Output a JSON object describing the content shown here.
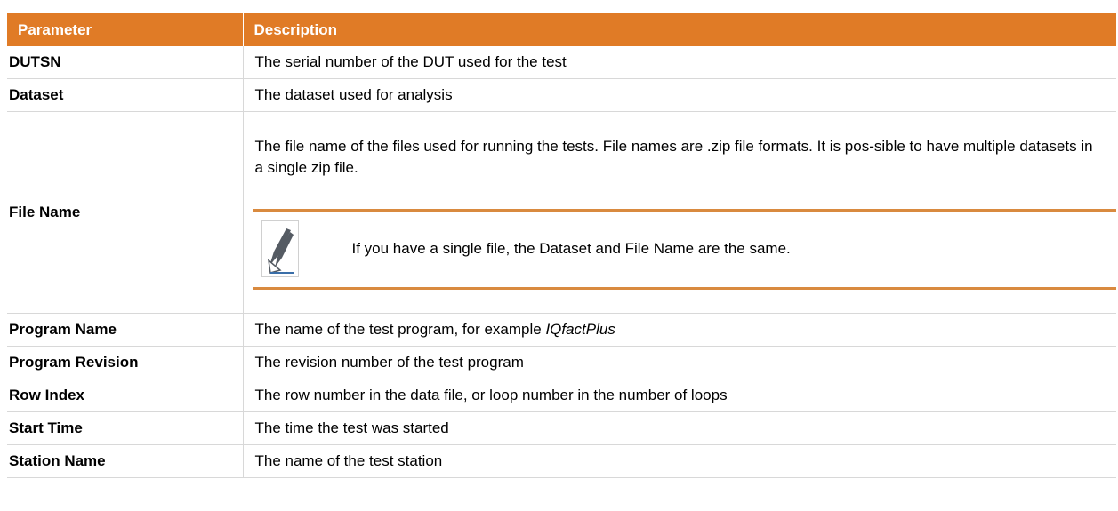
{
  "table": {
    "headers": {
      "param": "Parameter",
      "desc": "Description"
    },
    "rows": [
      {
        "param": "DUTSN",
        "desc": "The serial number of the DUT used for the test"
      },
      {
        "param": "Dataset",
        "desc": "The dataset used for analysis"
      },
      {
        "param": "File Name",
        "desc": "The file name of the files used for running the tests. File names are .zip file formats. It is pos-sible to have multiple datasets in a single zip file.",
        "note": "If you have a single file, the Dataset and File Name are the same.",
        "note_icon": "pencil-note-icon"
      },
      {
        "param": "Program Name",
        "desc_prefix": "The name of the test program, for example ",
        "desc_emph": "IQfactPlus"
      },
      {
        "param": "Program Revision",
        "desc": "The revision number of the test program"
      },
      {
        "param": "Row Index",
        "desc": "The row number in the data file, or loop number in the number of loops"
      },
      {
        "param": "Start Time",
        "desc": "The time the test was started"
      },
      {
        "param": "Station Name",
        "desc": "The name of the test station"
      }
    ]
  },
  "colors": {
    "header_bg": "#e07b26",
    "note_rule": "#d98a3f",
    "icon_dark": "#555b63",
    "icon_accent": "#3a6ea8"
  }
}
